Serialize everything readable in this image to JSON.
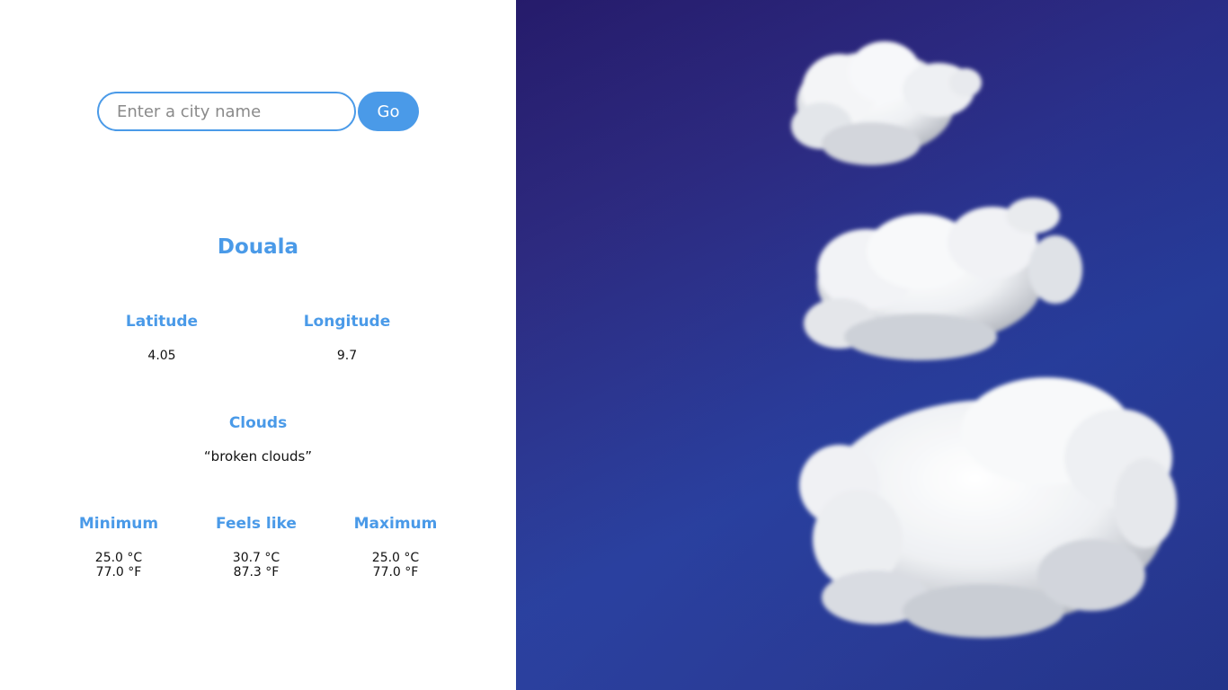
{
  "search": {
    "placeholder": "Enter a city name",
    "value": "",
    "button_label": "Go"
  },
  "city": {
    "name": "Douala"
  },
  "coordinates": {
    "latitude_label": "Latitude",
    "latitude_value": "4.05",
    "longitude_label": "Longitude",
    "longitude_value": "9.7"
  },
  "conditions": {
    "label": "Clouds",
    "description": "“broken clouds”"
  },
  "temperatures": {
    "minimum": {
      "label": "Minimum",
      "celsius": "25.0 °C",
      "fahrenheit": "77.0 °F"
    },
    "feels_like": {
      "label": "Feels like",
      "celsius": "30.7 °C",
      "fahrenheit": "87.3 °F"
    },
    "maximum": {
      "label": "Maximum",
      "celsius": "25.0 °C",
      "fahrenheit": "77.0 °F"
    }
  },
  "colors": {
    "accent": "#4a9ae8",
    "sky_top": "#1a0f63",
    "sky_bottom": "#263791"
  },
  "background_image": "clouds-sky-image"
}
